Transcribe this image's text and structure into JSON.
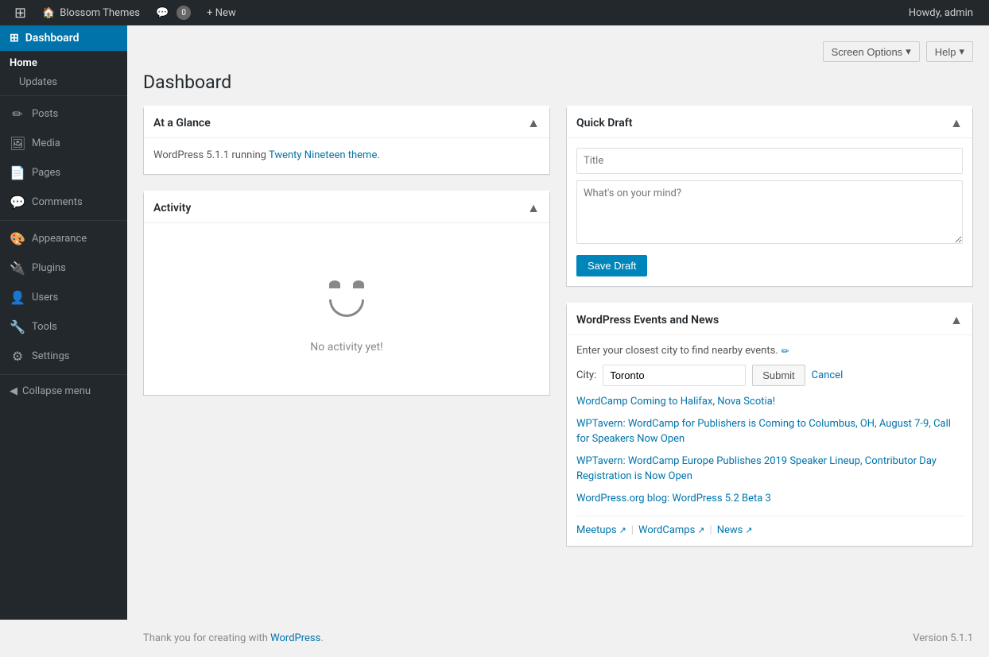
{
  "adminbar": {
    "site_name": "Blossom Themes",
    "comments_count": "0",
    "new_label": "+ New",
    "howdy": "Howdy, admin"
  },
  "topbar": {
    "screen_options_label": "Screen Options",
    "help_label": "Help"
  },
  "page": {
    "title": "Dashboard"
  },
  "sidebar": {
    "dashboard_label": "Dashboard",
    "home_label": "Home",
    "updates_label": "Updates",
    "posts_label": "Posts",
    "media_label": "Media",
    "pages_label": "Pages",
    "comments_label": "Comments",
    "appearance_label": "Appearance",
    "plugins_label": "Plugins",
    "users_label": "Users",
    "tools_label": "Tools",
    "settings_label": "Settings",
    "collapse_label": "Collapse menu"
  },
  "at_a_glance": {
    "title": "At a Glance",
    "content_prefix": "WordPress 5.1.1 running ",
    "theme_link_text": "Twenty Nineteen theme.",
    "content_suffix": ""
  },
  "activity": {
    "title": "Activity",
    "empty_text": "No activity yet!"
  },
  "quick_draft": {
    "title": "Quick Draft",
    "title_placeholder": "Title",
    "body_placeholder": "What's on your mind?",
    "save_label": "Save Draft"
  },
  "events_news": {
    "title": "WordPress Events and News",
    "description": "Enter your closest city to find nearby events.",
    "city_label": "City:",
    "city_value": "Toronto",
    "submit_label": "Submit",
    "cancel_label": "Cancel",
    "news_items": [
      "WordCamp Coming to Halifax, Nova Scotia!",
      "WPTavern: WordCamp for Publishers is Coming to Columbus, OH, August 7-9, Call for Speakers Now Open",
      "WPTavern: WordCamp Europe Publishes 2019 Speaker Lineup, Contributor Day Registration is Now Open",
      "WordPress.org blog: WordPress 5.2 Beta 3"
    ],
    "meetups_label": "Meetups",
    "wordcamps_label": "WordCamps",
    "news_label": "News"
  },
  "footer": {
    "thank_you_text": "Thank you for creating with ",
    "wordpress_link": "WordPress",
    "version_text": "Version 5.1.1"
  }
}
